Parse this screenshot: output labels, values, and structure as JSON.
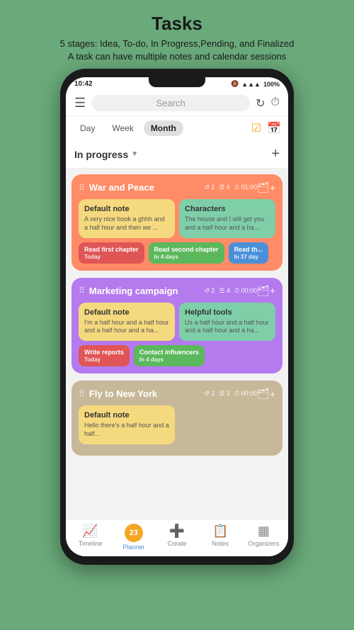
{
  "header": {
    "title": "Tasks",
    "subtitle_line1": "5 stages: Idea, To-do, In Progress,Pending, and Finalized",
    "subtitle_line2": "A task can have multiple notes and calendar sessions"
  },
  "status_bar": {
    "time": "10:42",
    "battery": "100%"
  },
  "toolbar": {
    "search_placeholder": "Search",
    "refresh_icon": "↻",
    "timer_icon": "⏱"
  },
  "date_tabs": {
    "day": "Day",
    "week": "Week",
    "month": "Month",
    "active": "Month"
  },
  "section": {
    "label": "In progress",
    "add_icon": "+"
  },
  "tasks": [
    {
      "id": "task1",
      "title": "War and Peace",
      "meta": [
        {
          "icon": "↺",
          "value": "2"
        },
        {
          "icon": "☰",
          "value": "6"
        },
        {
          "icon": "⏱",
          "value": "01:00"
        }
      ],
      "color": "orange",
      "notes": [
        {
          "title": "Default note",
          "text": "A very nice book a ghhh and a half hour and then we ...",
          "color": "yellow"
        },
        {
          "title": "Characters",
          "text": "The house and I will get you and a half hour and a ha...",
          "color": "green"
        }
      ],
      "sessions": [
        {
          "label": "Read first chapter",
          "sub": "Today",
          "color": "red"
        },
        {
          "label": "Read second chapter",
          "sub": "In 4 days",
          "color": "green"
        },
        {
          "label": "Read th...",
          "sub": "In 37 day",
          "color": "blue"
        }
      ]
    },
    {
      "id": "task2",
      "title": "Marketing campaign",
      "meta": [
        {
          "icon": "↺",
          "value": "2"
        },
        {
          "icon": "☰",
          "value": "4"
        },
        {
          "icon": "⏱",
          "value": "00:00"
        }
      ],
      "color": "purple",
      "notes": [
        {
          "title": "Default note",
          "text": "I'm a half hour and a half hour and a half hour and a ha...",
          "color": "yellow"
        },
        {
          "title": "Helpful tools",
          "text": "Us a half hour and a half hour and a half hour and a ha...",
          "color": "green"
        }
      ],
      "sessions": [
        {
          "label": "Write reports",
          "sub": "Today",
          "color": "red"
        },
        {
          "label": "Contact influencers",
          "sub": "In 4 days",
          "color": "green"
        }
      ]
    },
    {
      "id": "task3",
      "title": "Fly to New York",
      "meta": [
        {
          "icon": "↺",
          "value": "1"
        },
        {
          "icon": "☰",
          "value": "2"
        },
        {
          "icon": "⏱",
          "value": "00:00"
        }
      ],
      "color": "beige",
      "notes": [
        {
          "title": "Default note",
          "text": "Hello there's a half hour and a half...",
          "color": "yellow"
        }
      ],
      "sessions": []
    }
  ],
  "bottom_nav": [
    {
      "label": "Timeline",
      "icon": "📈",
      "active": false
    },
    {
      "label": "Planner",
      "icon": "23",
      "active": true
    },
    {
      "label": "Create",
      "icon": "➕",
      "active": false
    },
    {
      "label": "Notes",
      "icon": "📋",
      "active": false
    },
    {
      "label": "Organizers",
      "icon": "▦",
      "active": false
    }
  ]
}
